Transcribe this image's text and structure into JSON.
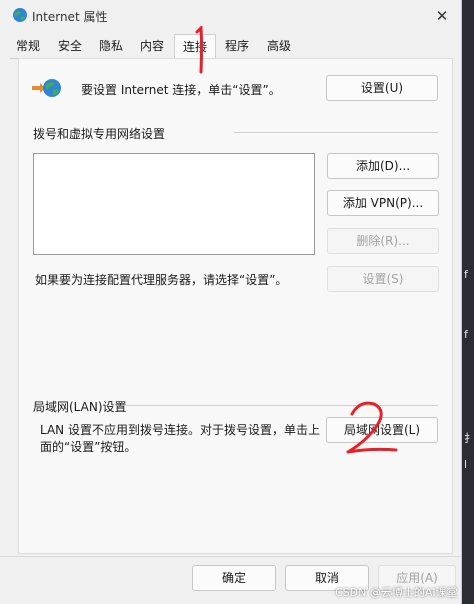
{
  "window": {
    "title": "Internet 属性",
    "close_symbol": "✕"
  },
  "tabs": [
    {
      "label": "常规"
    },
    {
      "label": "安全"
    },
    {
      "label": "隐私"
    },
    {
      "label": "内容"
    },
    {
      "label": "连接",
      "active": true
    },
    {
      "label": "程序"
    },
    {
      "label": "高级"
    }
  ],
  "setup": {
    "text": "要设置 Internet 连接，单击“设置”。",
    "button": "设置(U)",
    "icon": "globe-network-icon"
  },
  "dialup": {
    "heading": "拨号和虚拟专用网络设置",
    "add_button": "添加(D)...",
    "add_vpn_button": "添加 VPN(P)...",
    "remove_button": "删除(R)...",
    "proxy_hint": "如果要为连接配置代理服务器，请选择“设置”。",
    "settings_button": "设置(S)"
  },
  "lan": {
    "heading": "局域网(LAN)设置",
    "text_line1": "LAN 设置不应用到拨号连接。对于拨号设置，单击上",
    "text_line2": "面的“设置”按钮。",
    "button": "局域网设置(L)"
  },
  "footer": {
    "ok": "确定",
    "cancel": "取消",
    "apply": "应用(A)"
  },
  "annotations": {
    "mark1": "1",
    "mark2": "2",
    "color": "#e8202a"
  },
  "side_strip": {
    "chars": [
      "f",
      "f",
      "扌",
      "l"
    ]
  },
  "watermark": "CSDN @云博士的AI课堂"
}
